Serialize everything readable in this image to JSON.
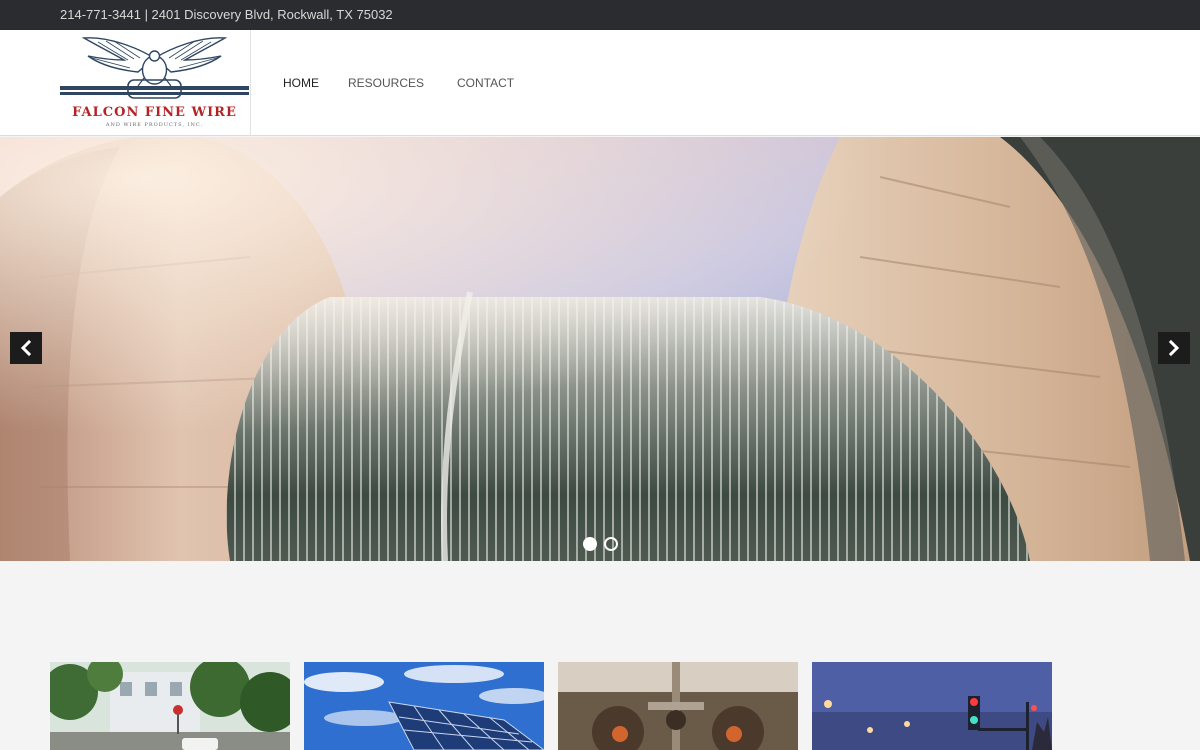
{
  "topbar": {
    "contact_line": "214-771-3441 | 2401 Discovery Blvd, Rockwall, TX 75032"
  },
  "logo": {
    "name": "FALCON FINE WIRE",
    "subtitle": "AND WIRE PRODUCTS, INC.",
    "icon": "falcon-emblem",
    "brand_color": "#b52226"
  },
  "nav": {
    "items": [
      {
        "label": "HOME",
        "active": true
      },
      {
        "label": "RESOURCES",
        "active": false
      },
      {
        "label": "CONTACT",
        "active": false
      }
    ]
  },
  "slider": {
    "slide_count": 2,
    "active_slide": 1,
    "image": "wire spool on wooden reel",
    "prev_icon": "chevron-left-icon",
    "next_icon": "chevron-right-icon"
  },
  "thumbnails": [
    {
      "image": "street with palm trees"
    },
    {
      "image": "solar panel array"
    },
    {
      "image": "wire machinery"
    },
    {
      "image": "traffic lights at dusk"
    }
  ]
}
